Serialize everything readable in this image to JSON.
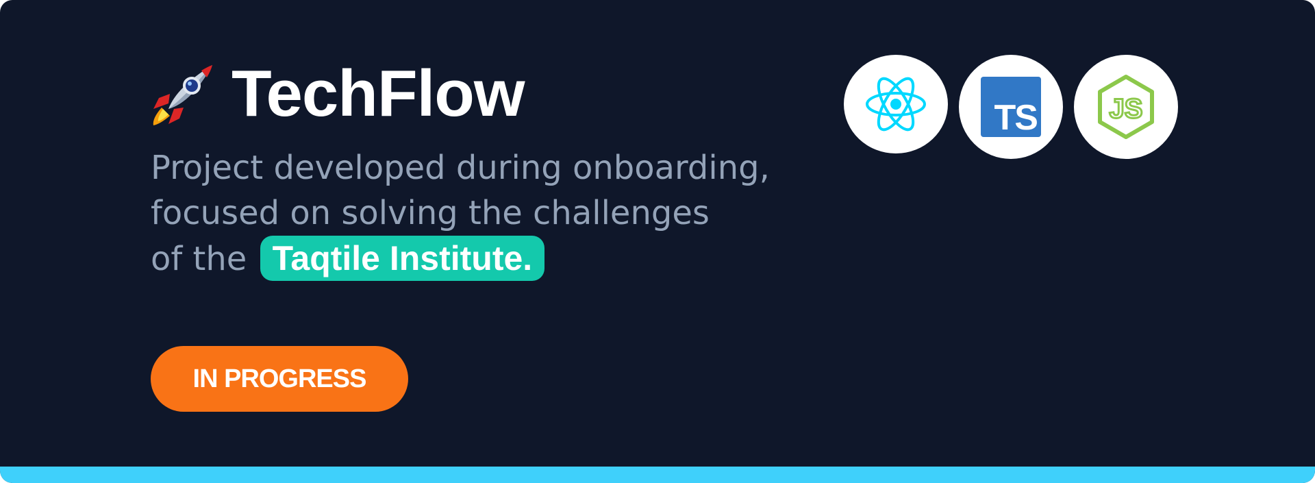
{
  "project": {
    "title": "TechFlow",
    "description_lines": [
      "Project developed during onboarding,",
      "focused on solving the challenges",
      "of the"
    ],
    "highlight": "Taqtile Institute.",
    "status": "IN PROGRESS"
  },
  "tech_stack": [
    {
      "icon": "react-icon",
      "label": "React"
    },
    {
      "icon": "typescript-icon",
      "label": "TS"
    },
    {
      "icon": "nodejs-icon",
      "label": "JS"
    }
  ],
  "colors": {
    "background": "#0f172a",
    "title": "#ffffff",
    "description": "#94a3b8",
    "highlight_bg": "#14c9ac",
    "status_bg": "#f97316",
    "accent_bar": "#3fd0fb",
    "react": "#00d8ff",
    "typescript": "#3178c6",
    "nodejs": "#8cc84b"
  }
}
